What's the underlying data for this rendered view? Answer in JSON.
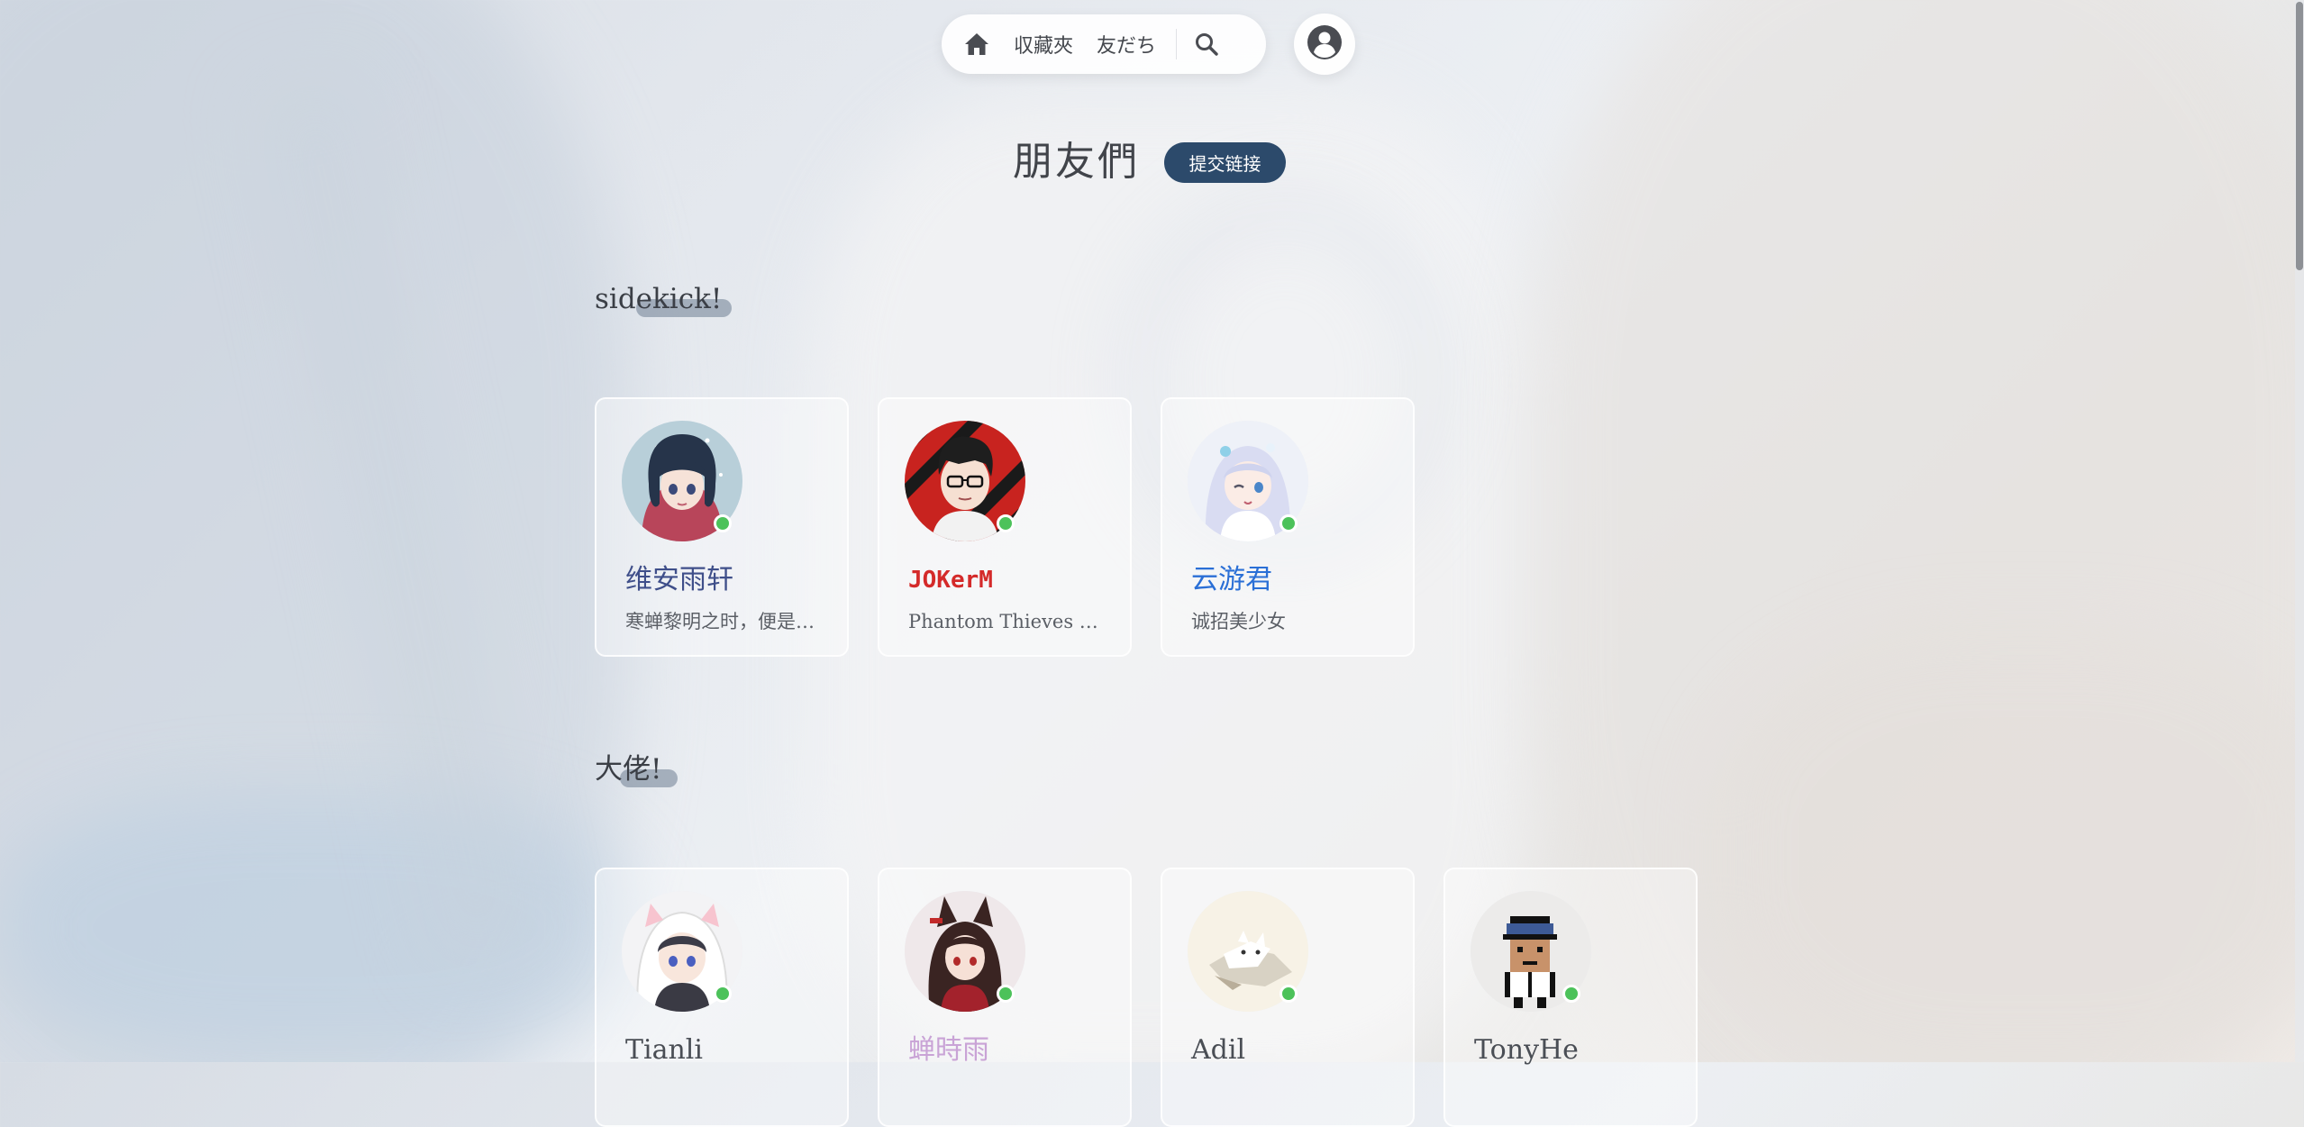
{
  "nav": {
    "home_icon": "home-icon",
    "links": [
      "収藏夾",
      "友だち"
    ],
    "search_icon": "search-icon",
    "user_icon": "user-circle-icon"
  },
  "page": {
    "title": "朋友們",
    "submit_label": "提交链接"
  },
  "sections": [
    {
      "title": "sidekick!",
      "friends": [
        {
          "name": "维安雨轩",
          "desc": "寒蝉黎明之时，便是…",
          "name_color": "#3f4f8a",
          "online": true
        },
        {
          "name": "JOKerM",
          "desc": "Phantom Thieves o…",
          "name_color": "#d42a2a",
          "online": true
        },
        {
          "name": "云游君",
          "desc": "诚招美少女",
          "name_color": "#2a6fd6",
          "online": true
        }
      ]
    },
    {
      "title": "大佬!",
      "friends": [
        {
          "name": "Tianli",
          "desc": "",
          "name_color": "#4a4e55",
          "online": true
        },
        {
          "name": "蝉時雨",
          "desc": "",
          "name_color": "#c9a3d6",
          "online": true
        },
        {
          "name": "Adil",
          "desc": "",
          "name_color": "#4a4e55",
          "online": true
        },
        {
          "name": "TonyHe",
          "desc": "",
          "name_color": "#4a4e55",
          "online": true
        }
      ]
    }
  ],
  "colors": {
    "accent": "#2c4a6b",
    "online": "#4cc25a"
  }
}
